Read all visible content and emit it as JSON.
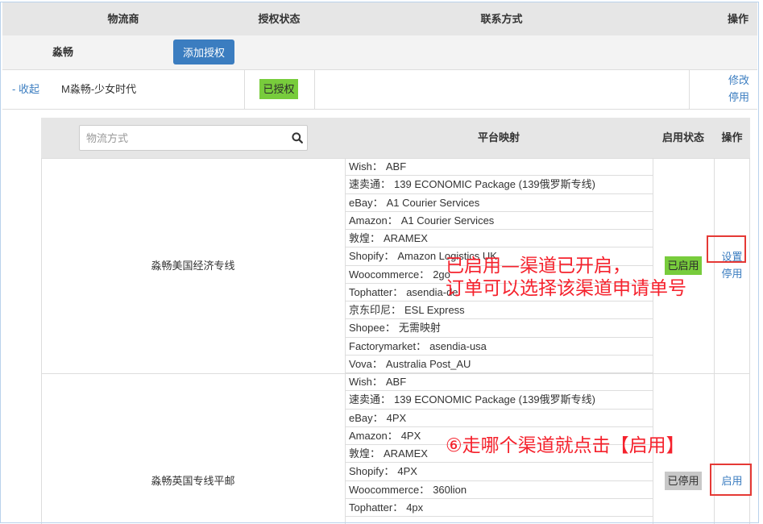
{
  "header": {
    "carrier": "物流商",
    "auth_status": "授权状态",
    "contact": "联系方式",
    "action": "操作"
  },
  "carrier_group": {
    "name": "淼畅",
    "add_auth_button": "添加授权"
  },
  "account": {
    "collapse_link": "- 收起",
    "name": "M淼畅-少女时代",
    "auth_badge": "已授权",
    "edit_link": "修改",
    "disable_link": "停用"
  },
  "channels": {
    "search_placeholder": "物流方式",
    "col_mapping": "平台映射",
    "col_status": "启用状态",
    "col_action": "操作",
    "rows": [
      {
        "name": "淼畅美国经济专线",
        "status": "已启用",
        "actions": [
          "设置",
          "停用"
        ],
        "mappings": [
          {
            "platform": "Wish：",
            "value": "ABF"
          },
          {
            "platform": "速卖通：",
            "value": "139 ECONOMIC Package (139俄罗斯专线)"
          },
          {
            "platform": "eBay：",
            "value": "A1 Courier Services"
          },
          {
            "platform": "Amazon：",
            "value": "A1 Courier Services"
          },
          {
            "platform": "敦煌：",
            "value": "ARAMEX"
          },
          {
            "platform": "Shopify：",
            "value": "Amazon Logistics UK"
          },
          {
            "platform": "Woocommerce：",
            "value": "2go"
          },
          {
            "platform": "Tophatter：",
            "value": "asendia-de"
          },
          {
            "platform": "京东印尼：",
            "value": "ESL Express"
          },
          {
            "platform": "Shopee：",
            "value": "无需映射"
          },
          {
            "platform": "Factorymarket：",
            "value": "asendia-usa"
          },
          {
            "platform": "Vova：",
            "value": "Australia Post_AU"
          }
        ]
      },
      {
        "name": "淼畅英国专线平邮",
        "status": "已停用",
        "actions": [
          "启用"
        ],
        "mappings": [
          {
            "platform": "Wish：",
            "value": "ABF"
          },
          {
            "platform": "速卖通：",
            "value": "139 ECONOMIC Package (139俄罗斯专线)"
          },
          {
            "platform": "eBay：",
            "value": "4PX"
          },
          {
            "platform": "Amazon：",
            "value": "4PX"
          },
          {
            "platform": "敦煌：",
            "value": "ARAMEX"
          },
          {
            "platform": "Shopify：",
            "value": "4PX"
          },
          {
            "platform": "Woocommerce：",
            "value": "360lion"
          },
          {
            "platform": "Tophatter：",
            "value": "4px"
          }
        ]
      }
    ]
  },
  "annotations": {
    "enabled_line1": "已启用—渠道已开启，",
    "enabled_line2": "订单可以选择该渠道申请单号",
    "step6": "⑥走哪个渠道就点击【启用】"
  },
  "icons": {
    "search": "search-icon"
  },
  "colors": {
    "link": "#3b7dc0",
    "primary_button": "#3b7dc0",
    "badge_enabled": "#78cc3c",
    "badge_disabled": "#c8c8c8",
    "header_bg": "#e6e6e6",
    "annotation_red": "#f5222d"
  }
}
